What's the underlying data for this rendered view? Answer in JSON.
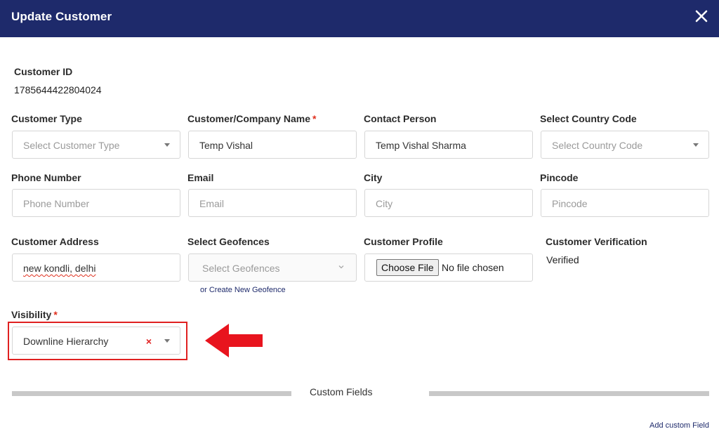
{
  "window": {
    "title": "Update Customer",
    "close_icon": "close-icon"
  },
  "customer_id": {
    "label": "Customer ID",
    "value": "1785644422804024"
  },
  "row1": {
    "customer_type": {
      "label": "Customer Type",
      "placeholder": "Select Customer Type"
    },
    "company_name": {
      "label": "Customer/Company Name",
      "required_mark": "*",
      "value": "Temp Vishal"
    },
    "contact_person": {
      "label": "Contact Person",
      "value": "Temp Vishal Sharma"
    },
    "country_code": {
      "label": "Select Country Code",
      "placeholder": "Select Country Code"
    }
  },
  "row2": {
    "phone": {
      "label": "Phone Number",
      "placeholder": "Phone Number"
    },
    "email": {
      "label": "Email",
      "placeholder": "Email"
    },
    "city": {
      "label": "City",
      "placeholder": "City"
    },
    "pincode": {
      "label": "Pincode",
      "placeholder": "Pincode"
    }
  },
  "row3": {
    "address": {
      "label": "Customer Address",
      "value": "new kondli, delhi"
    },
    "geofences": {
      "label": "Select Geofences",
      "placeholder": "Select Geofences",
      "create_link": "or Create New Geofence"
    },
    "profile": {
      "label": "Customer Profile",
      "button": "Choose File",
      "status": "No file chosen"
    },
    "verification": {
      "label": "Customer Verification",
      "value": "Verified"
    }
  },
  "visibility": {
    "label": "Visibility",
    "required_mark": "*",
    "value": "Downline Hierarchy",
    "clear_symbol": "×"
  },
  "custom_fields": {
    "label": "Custom Fields",
    "add_link": "Add custom Field"
  },
  "colors": {
    "header": "#1e2a6b",
    "required": "#e0301e",
    "annotation": "#e02020"
  }
}
